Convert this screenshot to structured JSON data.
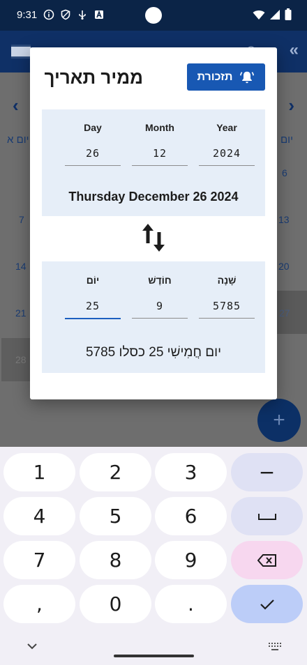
{
  "status_bar": {
    "time": "9:31",
    "icons": [
      "info-icon",
      "shield-icon",
      "usb-icon",
      "a-box-icon"
    ],
    "right_icons": [
      "wifi-icon",
      "signal-icon",
      "battery-icon"
    ]
  },
  "background": {
    "weekday_head_left": "יום א",
    "weekday_head_right": "יום",
    "dates": [
      "6",
      "7",
      "13",
      "14",
      "20",
      "21",
      "27",
      "28"
    ]
  },
  "dialog": {
    "title": "ממיר תאריך",
    "reminder_label": "תזכורת",
    "gregorian": {
      "day_label": "Day",
      "month_label": "Month",
      "year_label": "Year",
      "day_value": "26",
      "month_value": "12",
      "year_value": "2024",
      "result": "Thursday December 26 2024"
    },
    "hebrew": {
      "day_label": "יוֹם",
      "month_label": "חוֹדֶשׁ",
      "year_label": "שָׁנָה",
      "day_value": "25",
      "month_value": "9",
      "year_value": "5785",
      "result": "יום חֲמִישִׁי 25 כסלו 5785"
    }
  },
  "keyboard": {
    "keys": [
      "1",
      "2",
      "3",
      "−",
      "4",
      "5",
      "6",
      "␣",
      "7",
      "8",
      "9",
      "⌫",
      ",",
      "0",
      ".",
      "✓"
    ]
  },
  "colors": {
    "accent": "#1858b3",
    "panel": "#e6eef8",
    "status_bar": "#0b2447"
  }
}
